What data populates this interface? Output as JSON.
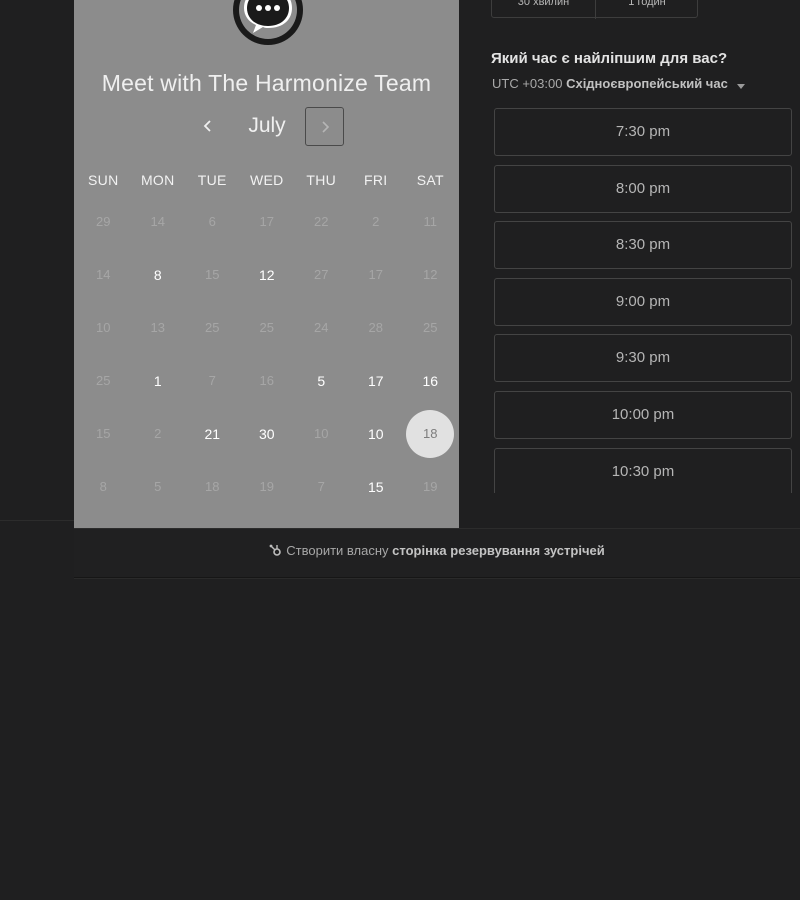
{
  "colors": {
    "page_background": "#1f1f20",
    "calendar_panel": "#8c8c8c",
    "selected_day_circle": "#e1e1e1"
  },
  "header": {
    "avatar_icon": "chat-bubble-ellipsis-icon",
    "title": "Meet with The Harmonize Team"
  },
  "calendar": {
    "month": "July",
    "prev_icon": "chevron-left-icon",
    "next_icon": "chevron-right-icon",
    "weekdays": [
      "SUN",
      "MON",
      "TUE",
      "WED",
      "THU",
      "FRI",
      "SAT"
    ],
    "weeks": [
      [
        {
          "d": "29",
          "s": "dim"
        },
        {
          "d": "14",
          "s": "dim"
        },
        {
          "d": "6",
          "s": "dim"
        },
        {
          "d": "17",
          "s": "dim"
        },
        {
          "d": "22",
          "s": "dim"
        },
        {
          "d": "2",
          "s": "dim"
        },
        {
          "d": "11",
          "s": "dim"
        }
      ],
      [
        {
          "d": "14",
          "s": "dim"
        },
        {
          "d": "8",
          "s": "avail"
        },
        {
          "d": "15",
          "s": "dim"
        },
        {
          "d": "12",
          "s": "avail"
        },
        {
          "d": "27",
          "s": "dim"
        },
        {
          "d": "17",
          "s": "dim"
        },
        {
          "d": "12",
          "s": "dim"
        }
      ],
      [
        {
          "d": "10",
          "s": "dim"
        },
        {
          "d": "13",
          "s": "dim"
        },
        {
          "d": "25",
          "s": "dim"
        },
        {
          "d": "25",
          "s": "dim"
        },
        {
          "d": "24",
          "s": "dim"
        },
        {
          "d": "28",
          "s": "dim"
        },
        {
          "d": "25",
          "s": "dim"
        }
      ],
      [
        {
          "d": "25",
          "s": "dim"
        },
        {
          "d": "1",
          "s": "avail"
        },
        {
          "d": "7",
          "s": "dim"
        },
        {
          "d": "16",
          "s": "dim"
        },
        {
          "d": "5",
          "s": "avail"
        },
        {
          "d": "17",
          "s": "avail"
        },
        {
          "d": "16",
          "s": "avail"
        }
      ],
      [
        {
          "d": "15",
          "s": "dim"
        },
        {
          "d": "2",
          "s": "dim"
        },
        {
          "d": "21",
          "s": "avail"
        },
        {
          "d": "30",
          "s": "avail"
        },
        {
          "d": "10",
          "s": "dim"
        },
        {
          "d": "10",
          "s": "avail"
        },
        {
          "d": "18",
          "s": "selected"
        }
      ],
      [
        {
          "d": "8",
          "s": "dim"
        },
        {
          "d": "5",
          "s": "dim"
        },
        {
          "d": "18",
          "s": "dim"
        },
        {
          "d": "19",
          "s": "dim"
        },
        {
          "d": "7",
          "s": "dim"
        },
        {
          "d": "15",
          "s": "avail"
        },
        {
          "d": "19",
          "s": "dim"
        }
      ]
    ]
  },
  "durations": {
    "options": [
      "30 хвилин",
      "1 годин"
    ]
  },
  "scheduler": {
    "question": "Який час є найліпшим для вас?",
    "timezone_prefix": "UTC +03:00",
    "timezone_name": "Східноєвропейський час",
    "timezone_caret_icon": "caret-down-icon",
    "slots": [
      "7:30 pm",
      "8:00 pm",
      "8:30 pm",
      "9:00 pm",
      "9:30 pm",
      "10:00 pm",
      "10:30 pm"
    ]
  },
  "footer": {
    "icon": "hubspot-sprocket-icon",
    "prefix": "Створити власну",
    "link": "сторінка резервування зустрічей"
  }
}
